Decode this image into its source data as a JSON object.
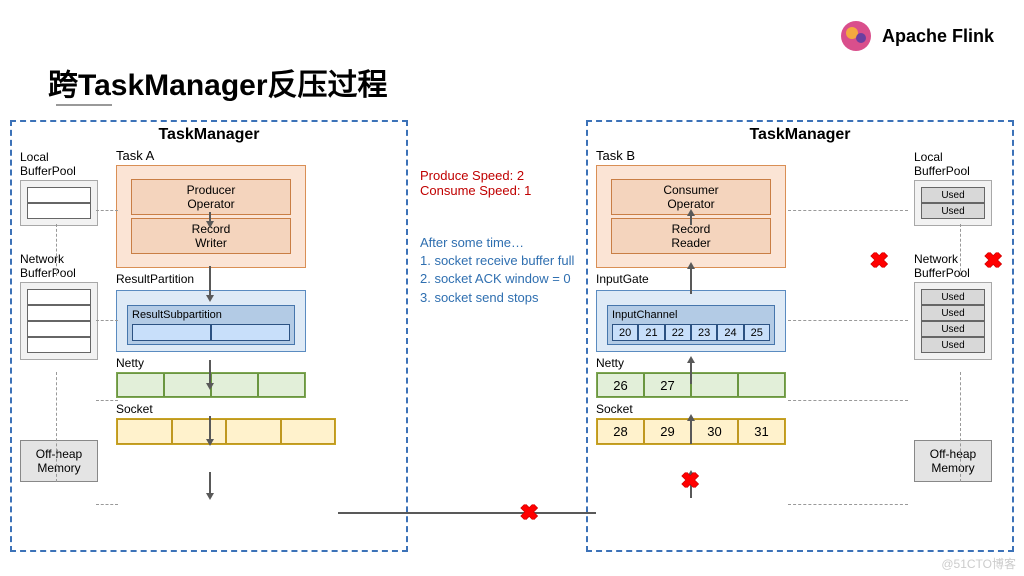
{
  "header": {
    "brand": "Apache Flink"
  },
  "title": "跨TaskManager反压过程",
  "tm": {
    "label": "TaskManager"
  },
  "pools": {
    "local": "Local\nBufferPool",
    "network": "Network\nBufferPool",
    "offheap": "Off-heap\nMemory",
    "used": "Used"
  },
  "left": {
    "task_label": "Task A",
    "producer": "Producer\nOperator",
    "record_writer": "Record\nWriter",
    "rp": "ResultPartition",
    "rsp": "ResultSubpartition",
    "netty": "Netty",
    "socket": "Socket"
  },
  "right": {
    "task_label": "Task B",
    "consumer": "Consumer\nOperator",
    "record_reader": "Record\nReader",
    "ig": "InputGate",
    "ic": "InputChannel",
    "ic_vals": [
      "20",
      "21",
      "22",
      "23",
      "24",
      "25"
    ],
    "netty": "Netty",
    "netty_vals": [
      "26",
      "27",
      "",
      ""
    ],
    "socket": "Socket",
    "socket_vals": [
      "28",
      "29",
      "30",
      "31"
    ]
  },
  "center": {
    "ps": "Produce Speed:   2",
    "cs": "Consume Speed:  1",
    "after_title": "After some time…",
    "after1": "1.    socket receive buffer full",
    "after2": "2.    socket ACK window = 0",
    "after3": "3.    socket send stops"
  },
  "watermark": "@51CTO博客",
  "chart_data": {
    "type": "diagram",
    "title": "Cross-TaskManager Backpressure Process",
    "nodes": [
      {
        "id": "tmA",
        "label": "TaskManager (left)",
        "contains": [
          "local_bp_A",
          "net_bp_A",
          "offheap_A",
          "taskA"
        ]
      },
      {
        "id": "taskA",
        "label": "Task A",
        "contains": [
          "producer_op",
          "record_writer",
          "result_partition",
          "netty_A",
          "socket_A"
        ]
      },
      {
        "id": "producer_op",
        "label": "Producer Operator"
      },
      {
        "id": "record_writer",
        "label": "Record Writer"
      },
      {
        "id": "result_partition",
        "label": "ResultPartition",
        "contains": [
          "result_subpartition"
        ]
      },
      {
        "id": "result_subpartition",
        "label": "ResultSubpartition",
        "slots": 2,
        "state": "empty"
      },
      {
        "id": "netty_A",
        "label": "Netty",
        "slots": 4,
        "state": "empty"
      },
      {
        "id": "socket_A",
        "label": "Socket",
        "slots": 4,
        "state": "empty"
      },
      {
        "id": "local_bp_A",
        "label": "Local BufferPool",
        "slots": 2,
        "state": "empty"
      },
      {
        "id": "net_bp_A",
        "label": "Network BufferPool",
        "slots": 4,
        "state": "empty"
      },
      {
        "id": "offheap_A",
        "label": "Off-heap Memory"
      },
      {
        "id": "tmB",
        "label": "TaskManager (right)",
        "contains": [
          "local_bp_B",
          "net_bp_B",
          "offheap_B",
          "taskB"
        ]
      },
      {
        "id": "taskB",
        "label": "Task B",
        "contains": [
          "consumer_op",
          "record_reader",
          "input_gate",
          "netty_B",
          "socket_B"
        ]
      },
      {
        "id": "consumer_op",
        "label": "Consumer Operator"
      },
      {
        "id": "record_reader",
        "label": "Record Reader"
      },
      {
        "id": "input_gate",
        "label": "InputGate",
        "contains": [
          "input_channel"
        ]
      },
      {
        "id": "input_channel",
        "label": "InputChannel",
        "slots": 6,
        "values": [
          20,
          21,
          22,
          23,
          24,
          25
        ],
        "state": "full"
      },
      {
        "id": "netty_B",
        "label": "Netty",
        "slots": 4,
        "values": [
          26,
          27,
          null,
          null
        ]
      },
      {
        "id": "socket_B",
        "label": "Socket",
        "slots": 4,
        "values": [
          28,
          29,
          30,
          31
        ],
        "state": "full"
      },
      {
        "id": "local_bp_B",
        "label": "Local BufferPool",
        "slots": 2,
        "state": "full",
        "cell_label": "Used"
      },
      {
        "id": "net_bp_B",
        "label": "Network BufferPool",
        "slots": 4,
        "state": "full",
        "cell_label": "Used"
      },
      {
        "id": "offheap_B",
        "label": "Off-heap Memory"
      }
    ],
    "edges": [
      {
        "from": "producer_op",
        "to": "record_writer"
      },
      {
        "from": "record_writer",
        "to": "result_subpartition"
      },
      {
        "from": "result_subpartition",
        "to": "netty_A"
      },
      {
        "from": "netty_A",
        "to": "socket_A"
      },
      {
        "from": "socket_A",
        "to": "socket_B",
        "blocked": true
      },
      {
        "from": "socket_B",
        "to": "netty_B",
        "blocked": true
      },
      {
        "from": "netty_B",
        "to": "input_channel"
      },
      {
        "from": "input_channel",
        "to": "record_reader"
      },
      {
        "from": "record_reader",
        "to": "consumer_op"
      },
      {
        "from": "local_bp_A",
        "to": "result_partition",
        "style": "dashed",
        "bidir": true
      },
      {
        "from": "net_bp_A",
        "to": "local_bp_A",
        "style": "dashed"
      },
      {
        "from": "net_bp_A",
        "to": "netty_A",
        "style": "dashed",
        "bidir": true
      },
      {
        "from": "offheap_A",
        "to": "netty_A",
        "style": "dashed",
        "bidir": true
      },
      {
        "from": "offheap_A",
        "to": "net_bp_A",
        "style": "dashed"
      },
      {
        "from": "input_gate",
        "to": "local_bp_B",
        "style": "dashed",
        "bidir": true,
        "blocked": true
      },
      {
        "from": "local_bp_B",
        "to": "net_bp_B",
        "style": "dashed",
        "blocked": true
      },
      {
        "from": "netty_B",
        "to": "net_bp_B",
        "style": "dashed",
        "bidir": true
      },
      {
        "from": "netty_B",
        "to": "offheap_B",
        "style": "dashed",
        "bidir": true
      },
      {
        "from": "net_bp_B",
        "to": "offheap_B",
        "style": "dashed"
      }
    ],
    "annotations": {
      "produce_speed": 2,
      "consume_speed": 1,
      "after_some_time": [
        "socket receive buffer full",
        "socket ACK window = 0",
        "socket send stops"
      ]
    }
  }
}
